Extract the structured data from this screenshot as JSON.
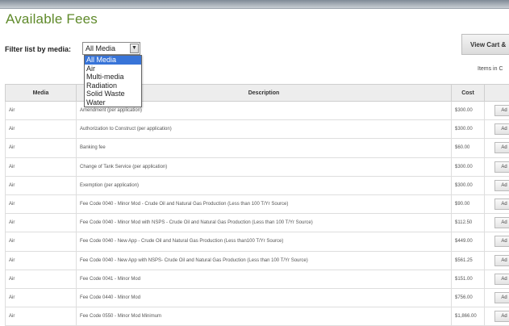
{
  "page": {
    "title": "Available Fees"
  },
  "filter": {
    "label": "Filter list by media:",
    "selected": "All Media",
    "options": [
      "All Media",
      "Air",
      "Multi-media",
      "Radiation",
      "Solid Waste",
      "Water"
    ]
  },
  "cart": {
    "button_label": "View Cart &",
    "items_label": "Items in C"
  },
  "table": {
    "headers": {
      "media": "Media",
      "description": "Description",
      "cost": "Cost"
    },
    "add_label": "Ad",
    "rows": [
      {
        "media": "Air",
        "description": "Amendment (per application)",
        "cost": "$300.00"
      },
      {
        "media": "Air",
        "description": "Authorization to Construct (per application)",
        "cost": "$300.00"
      },
      {
        "media": "Air",
        "description": "Banking fee",
        "cost": "$60.00"
      },
      {
        "media": "Air",
        "description": "Change of Tank Service (per application)",
        "cost": "$300.00"
      },
      {
        "media": "Air",
        "description": "Exemption (per application)",
        "cost": "$300.00"
      },
      {
        "media": "Air",
        "description": "Fee Code 0040 - Minor Mod - Crude Oil and Natural Gas Production (Less than 100 T/Yr Source)",
        "cost": "$90.00"
      },
      {
        "media": "Air",
        "description": "Fee Code 0040 - Minor Mod with NSPS - Crude Oil and Natural Gas Production (Less than 100 T/Yr Source)",
        "cost": "$112.50"
      },
      {
        "media": "Air",
        "description": "Fee Code 0040 - New App - Crude Oil and Natural Gas Production (Less than100 T/Yr Source)",
        "cost": "$449.00"
      },
      {
        "media": "Air",
        "description": "Fee Code 0040 - New App with NSPS- Crude Oil and Natural Gas Production (Less than 100 T/Yr Source)",
        "cost": "$561.25"
      },
      {
        "media": "Air",
        "description": "Fee Code 0041 - Minor Mod",
        "cost": "$151.00"
      },
      {
        "media": "Air",
        "description": "Fee Code 0440 - Minor Mod",
        "cost": "$756.00"
      },
      {
        "media": "Air",
        "description": "Fee Code 0550 - Minor Mod Minimum",
        "cost": "$1,866.00"
      }
    ]
  }
}
